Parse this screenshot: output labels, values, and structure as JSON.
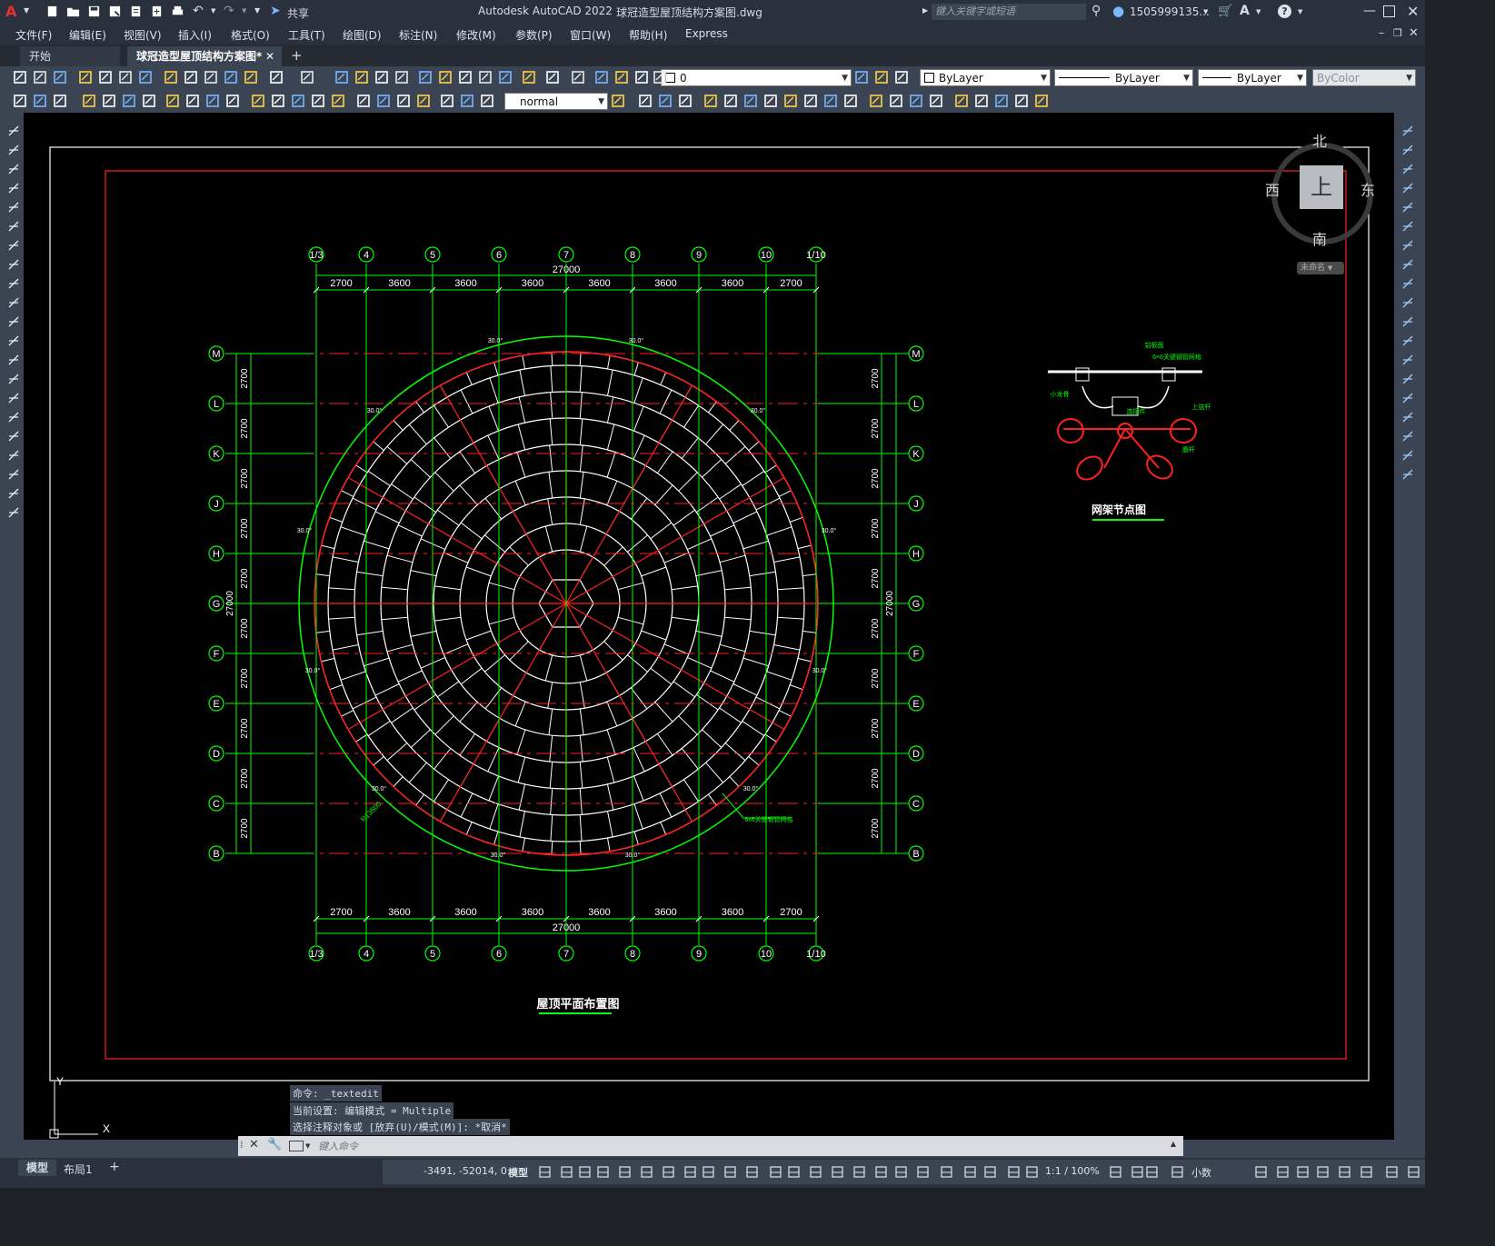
{
  "titlebar": {
    "app_title": "Autodesk AutoCAD 2022",
    "file_name": "球冠造型屋顶结构方案图.dwg",
    "share_label": "共享",
    "search_placeholder": "键入关键字或短语",
    "user_name": "1505999135..."
  },
  "menu": {
    "items": [
      "文件(F)",
      "编辑(E)",
      "视图(V)",
      "插入(I)",
      "格式(O)",
      "工具(T)",
      "绘图(D)",
      "标注(N)",
      "修改(M)",
      "参数(P)",
      "窗口(W)",
      "帮助(H)",
      "Express"
    ]
  },
  "tabs": {
    "start": "开始",
    "active": "球冠造型屋顶结构方案图*"
  },
  "toolbar": {
    "layer_value": "0",
    "color_value": "ByLayer",
    "linetype_value": "ByLayer",
    "lineweight_value": "ByLayer",
    "plotstyle_value": "ByColor",
    "textstyle_value": "normal"
  },
  "viewcube": {
    "north": "北",
    "south": "南",
    "east": "东",
    "west": "西",
    "face": "上",
    "wcs_label": "未命名"
  },
  "drawing": {
    "plan_title": "屋顶平面布置图",
    "node_title": "网架节点图",
    "overall_dim": "27000",
    "column_axes": [
      "1/3",
      "4",
      "5",
      "6",
      "7",
      "8",
      "9",
      "10",
      "1/10"
    ],
    "column_spacings": [
      "2700",
      "3600",
      "3600",
      "3600",
      "3600",
      "3600",
      "3600",
      "2700"
    ],
    "row_axes": [
      "M",
      "L",
      "K",
      "J",
      "H",
      "G",
      "F",
      "E",
      "D",
      "C",
      "B"
    ],
    "row_spacing": "2700",
    "angle_label": "30.0°",
    "radius_label": "R13500",
    "note_label": "6x6关键钢管网格",
    "node_labels": [
      "铝板面",
      "6×6关键钢管网格",
      "小龙骨",
      "连接件",
      "上弦杆",
      "腹杆"
    ]
  },
  "command": {
    "line1": "命令: _textedit",
    "line2": "当前设置: 编辑模式 = Multiple",
    "line3": "选择注释对象或 [放弃(U)/模式(M)]: *取消*",
    "placeholder": "键入命令"
  },
  "statusbar": {
    "model_tab": "模型",
    "layout_tab": "布局1",
    "coords": "-3491, -52014, 0",
    "model_label": "模型",
    "scale": "1:1 / 100%",
    "units": "小数"
  },
  "colors": {
    "grid_green": "#00ff00",
    "struct_red": "#ff2020",
    "mesh_white": "#ffffff",
    "bg_ui": "#3b4453",
    "bg_titlebar": "#2b313c"
  }
}
